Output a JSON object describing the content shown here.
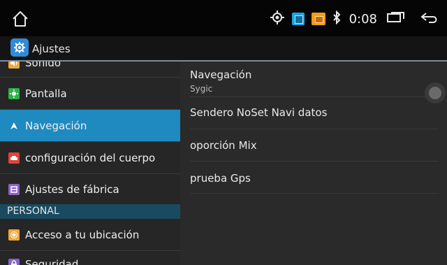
{
  "status": {
    "time": "0:08",
    "icons": [
      "home-icon",
      "location-icon",
      "gallery-app-icon",
      "media-app-icon",
      "bluetooth-icon",
      "recent-apps-icon",
      "back-icon"
    ]
  },
  "app": {
    "title": "Ajustes",
    "icon": "settings-gear-icon"
  },
  "sidebar": {
    "items": [
      {
        "label": "Sonido",
        "icon": "sound-icon",
        "color": "#f2a73b"
      },
      {
        "label": "Pantalla",
        "icon": "display-icon",
        "color": "#2bb24c"
      },
      {
        "label": "Navegación",
        "icon": "navigation-icon",
        "color": "#1f8ac0",
        "selected": true
      },
      {
        "label": "configuración del cuerpo",
        "icon": "vehicle-icon",
        "color": "#e0443b"
      },
      {
        "label": "Ajustes de fábrica",
        "icon": "factory-settings-icon",
        "color": "#8a63c8"
      }
    ],
    "section_header": "PERSONAL",
    "personal_items": [
      {
        "label": "Acceso a tu ubicación",
        "icon": "location-access-icon",
        "color": "#f2a73b"
      },
      {
        "label": "Seguridad",
        "icon": "security-icon",
        "color": "#8a63c8"
      }
    ]
  },
  "detail": {
    "items": [
      {
        "title": "Navegación",
        "subtitle": "Sygic"
      },
      {
        "title": "Sendero NoSet Navi datos"
      },
      {
        "title": "oporción Mix"
      },
      {
        "title": "prueba Gps"
      }
    ]
  },
  "colors": {
    "accent": "#1f8ac0",
    "section_header_bg": "#184b60",
    "background": "#262626"
  }
}
